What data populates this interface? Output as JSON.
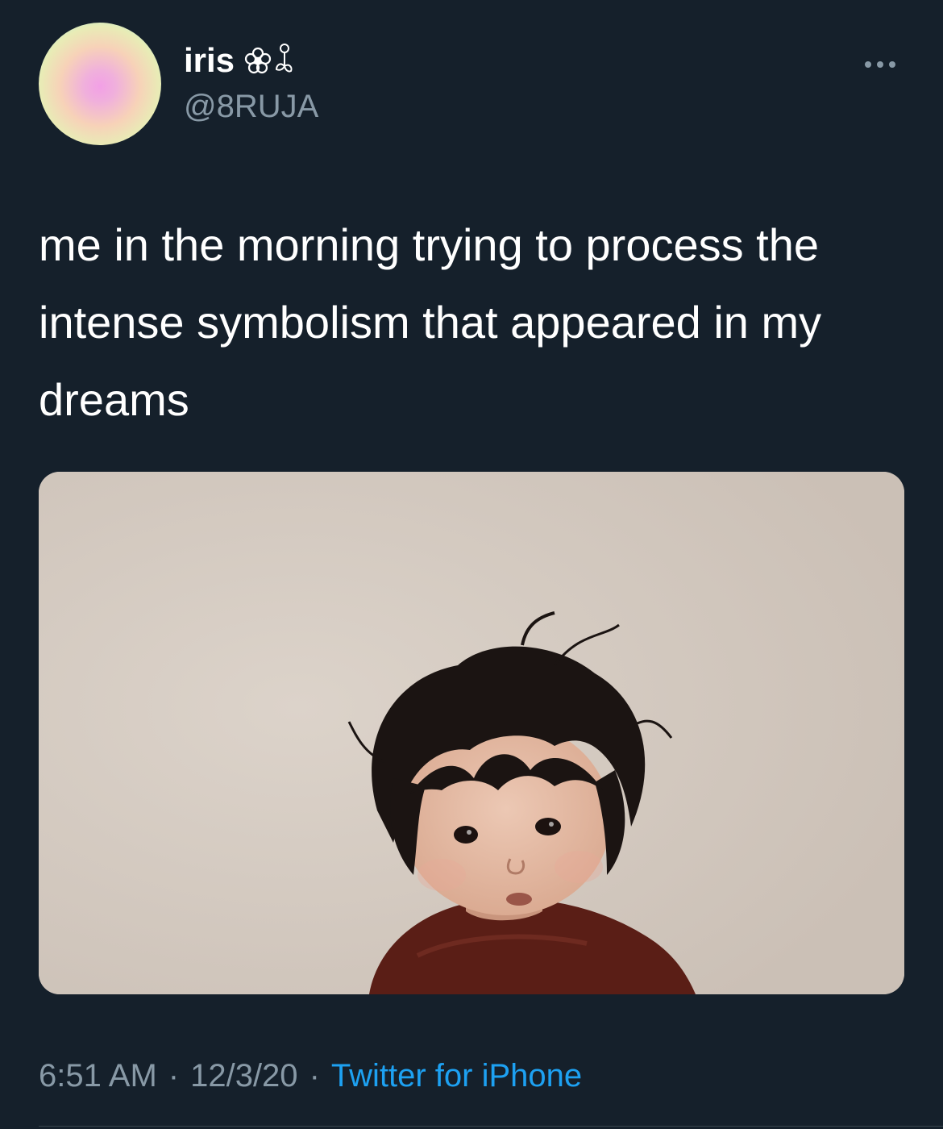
{
  "author": {
    "display_name": "iris",
    "handle": "@8RUJA"
  },
  "tweet": {
    "text": "me in the morning trying to process the intense symbolism that appeared in my dreams",
    "time": "6:51 AM",
    "date": "12/3/20",
    "source": "Twitter for iPhone",
    "separator": "·"
  },
  "icons": {
    "more": "more-horizontal-icon",
    "name_decoration": "flower-emoji-icon"
  },
  "colors": {
    "background": "#15202b",
    "secondary_text": "#8899a6",
    "link": "#1da1f2"
  }
}
